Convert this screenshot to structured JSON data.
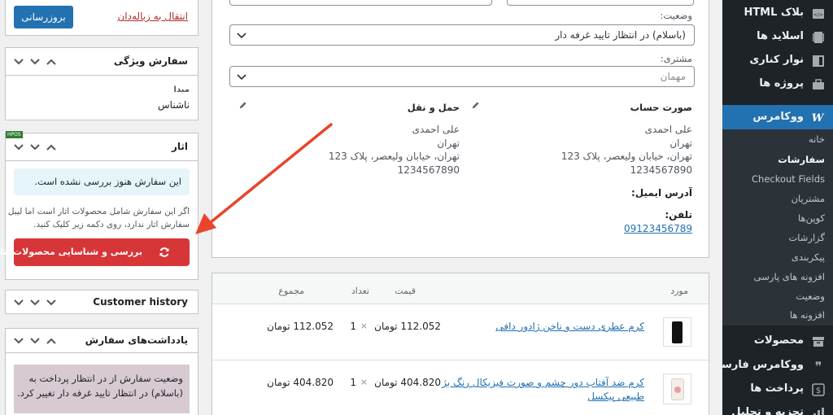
{
  "sidebar": {
    "menu": [
      {
        "label": "بلاک HTML",
        "icon": "html-block-icon"
      },
      {
        "label": "اسلاید ها",
        "icon": "slides-icon"
      },
      {
        "label": "نوار کناری",
        "icon": "sidebar-icon"
      },
      {
        "label": "پروژه ها",
        "icon": "briefcase-icon"
      },
      {
        "label": "ووکامرس",
        "icon": "woocommerce-icon"
      },
      {
        "label": "محصولات",
        "icon": "archive-icon"
      },
      {
        "label": "ووکامرس فارسی",
        "icon": "chat-bubble-icon"
      },
      {
        "label": "پرداخت ها",
        "icon": "payment-icon"
      },
      {
        "label": "تجزیه و تحلیل",
        "icon": "analytics-icon"
      }
    ],
    "submenu": [
      "خانه",
      "سفارشات",
      "Checkout Fields",
      "مشتریان",
      "کوپن‌ها",
      "گزارشات",
      "پیکربندی",
      "افزونه های پارسی",
      "وضعیت",
      "افزونه ها"
    ]
  },
  "actions": {
    "update_button": "بروزرسانی",
    "trash_link": "انتقال به زباله‌دان"
  },
  "attribution": {
    "title": "سفارش ویژگی",
    "origin_label": "مبدا",
    "origin_value": "ناشناس"
  },
  "tracking": {
    "title": "اثار",
    "badge": "HPOS",
    "notice": "این سفارش هنوز بررسی نشده است.",
    "description_line1": "اگر این سفارش شامل محصولات اثار است اما لیبل",
    "description_line2": "سفارش اثار ندارد، روی دکمه زیر کلیک کنید.",
    "check_button": "بررسی و شناسایی محصولات اثار",
    "accent": "#d63638"
  },
  "customer_history": {
    "title": "Customer history"
  },
  "notes": {
    "title": "یادداشت‌های سفارش",
    "note_line1": "وضعیت سفارش از در انتظار پرداخت به",
    "note_line2": "(باسلام) در انتظار تایید غرفه دار تغییر کرد."
  },
  "order": {
    "status_label": "وضعیت:",
    "status_value": "(باسلام) در انتظار تایید غرفه دار",
    "customer_label": "مشتری:",
    "customer_value": "مهمان",
    "billing": {
      "heading": "صورت حساب",
      "name": "علی احمدی",
      "city": "تهران",
      "street": "تهران، خیابان ولیعصر، پلاک 123",
      "postcode": "1234567890",
      "email_label": "آدرس ایمیل:",
      "phone_label": "تلفن:",
      "phone": "09123456789"
    },
    "shipping": {
      "heading": "حمل و نقل",
      "name": "علی احمدی",
      "city": "تهران",
      "street": "تهران، خیابان ولیعصر، پلاک 123",
      "postcode": "1234567890"
    }
  },
  "items": {
    "columns": {
      "item": "مورد",
      "price": "قیمت",
      "qty": "تعداد",
      "total": "مجموع"
    },
    "rows": [
      {
        "name": "کرم عطری دست و ناخن ژادور دافی",
        "name2": "",
        "price": "112.052 تومان",
        "times": "×",
        "qty": "1",
        "total": "112.052 تومان"
      },
      {
        "name": "کرم ضد آفتاب دور چشم و صورت فیزیکال رنگ بژ",
        "name2": "طبیعی پیکسل",
        "price": "404.820 تومان",
        "times": "×",
        "qty": "1",
        "total": "404.820 تومان"
      }
    ]
  }
}
